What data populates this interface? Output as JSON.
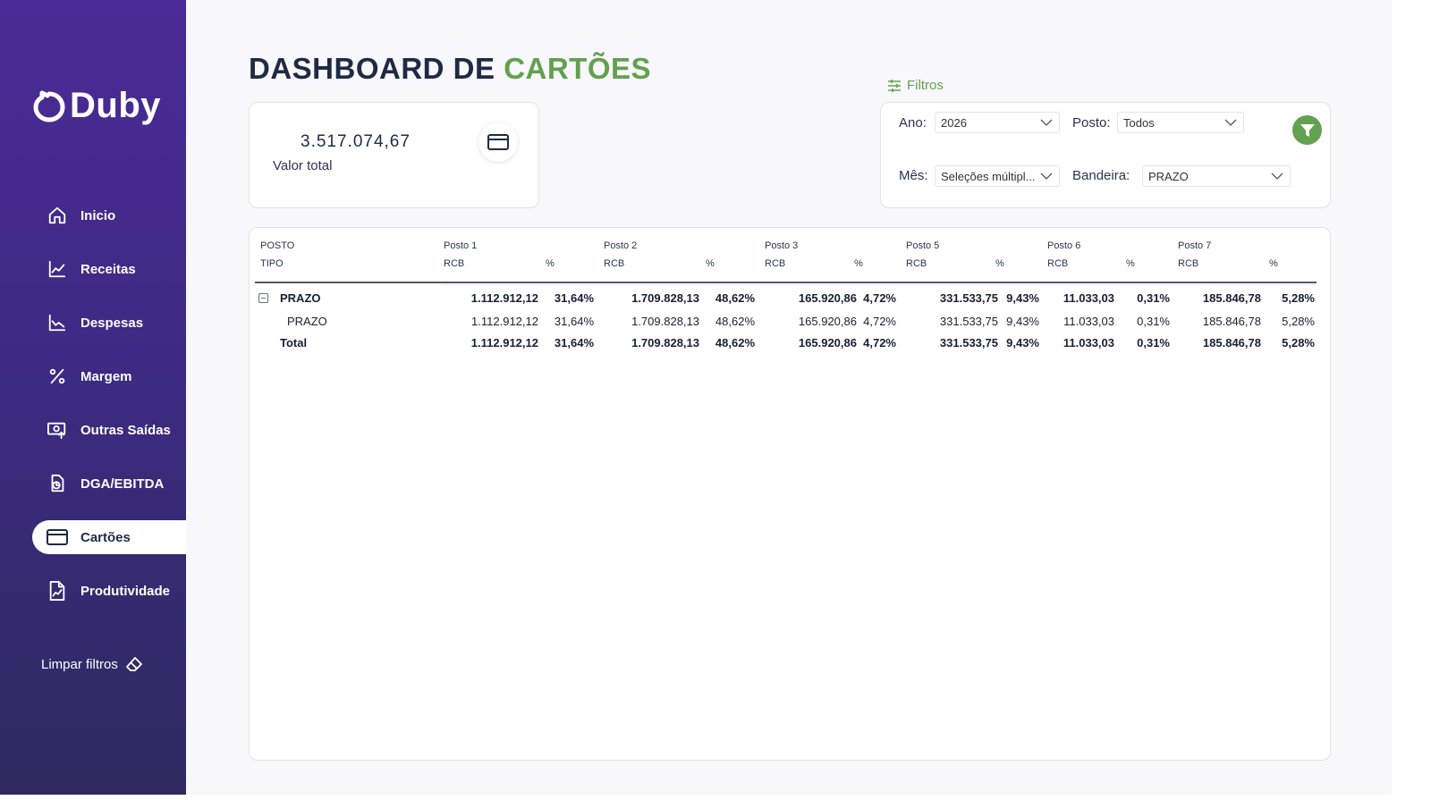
{
  "brand": {
    "name": "Duby"
  },
  "nav": {
    "items": [
      {
        "label": "Inicio",
        "icon": "home-icon",
        "active": false
      },
      {
        "label": "Receitas",
        "icon": "line-chart-icon",
        "active": false
      },
      {
        "label": "Despesas",
        "icon": "line-chart-down-icon",
        "active": false
      },
      {
        "label": "Margem",
        "icon": "percent-icon",
        "active": false
      },
      {
        "label": "Outras Saídas",
        "icon": "money-out-icon",
        "active": false
      },
      {
        "label": "DGA/EBITDA",
        "icon": "document-chart-icon",
        "active": false
      },
      {
        "label": "Cartões",
        "icon": "credit-card-icon",
        "active": true
      },
      {
        "label": "Produtividade",
        "icon": "report-chart-icon",
        "active": false
      }
    ],
    "clear_filters": "Limpar filtros"
  },
  "header": {
    "title_prefix": "DASHBOARD DE ",
    "title_accent": "CARTÕES"
  },
  "kpi": {
    "value": "3.517.074,67",
    "label": "Valor total"
  },
  "filters": {
    "title": "Filtros",
    "ano_label": "Ano:",
    "ano_value": "2026",
    "posto_label": "Posto:",
    "posto_value": "Todos",
    "mes_label": "Mês:",
    "mes_value": "Seleções múltipl...",
    "bandeira_label": "Bandeira:",
    "bandeira_value": "PRAZO"
  },
  "table": {
    "row_header_1": "POSTO",
    "row_header_2": "TIPO",
    "columns": [
      "Posto 1",
      "Posto 2",
      "Posto 3",
      "Posto 5",
      "Posto 6",
      "Posto 7"
    ],
    "sub_rcb": "RCB",
    "sub_pct": "%",
    "group": {
      "label": "PRAZO",
      "rcb": [
        "1.112.912,12",
        "1.709.828,13",
        "165.920,86",
        "331.533,75",
        "11.033,03",
        "185.846,78"
      ],
      "pct": [
        "31,64%",
        "48,62%",
        "4,72%",
        "9,43%",
        "0,31%",
        "5,28%"
      ]
    },
    "detail": {
      "label": "PRAZO",
      "rcb": [
        "1.112.912,12",
        "1.709.828,13",
        "165.920,86",
        "331.533,75",
        "11.033,03",
        "185.846,78"
      ],
      "pct": [
        "31,64%",
        "48,62%",
        "4,72%",
        "9,43%",
        "0,31%",
        "5,28%"
      ]
    },
    "total": {
      "label": "Total",
      "rcb": [
        "1.112.912,12",
        "1.709.828,13",
        "165.920,86",
        "331.533,75",
        "11.033,03",
        "185.846,78"
      ],
      "pct": [
        "31,64%",
        "48,62%",
        "4,72%",
        "9,43%",
        "0,31%",
        "5,28%"
      ]
    }
  }
}
